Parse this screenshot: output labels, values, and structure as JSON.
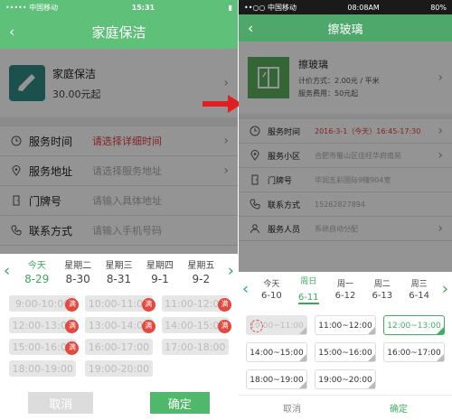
{
  "left": {
    "status": {
      "carrier": "••••• 中国移动",
      "time": "15:31",
      "battery": "▮"
    },
    "title": "家庭保洁",
    "service": {
      "name": "家庭保洁",
      "price": "30.00元起"
    },
    "rows": [
      {
        "label": "服务时间",
        "value": "请选择详细时间",
        "red": true,
        "icon": "clock-icon"
      },
      {
        "label": "服务地址",
        "value": "请选择服务地址",
        "red": false,
        "icon": "location-icon"
      },
      {
        "label": "门牌号",
        "value": "请输入具体地址",
        "red": false,
        "icon": "door-icon"
      },
      {
        "label": "联系方式",
        "value": "请输入手机号码",
        "red": false,
        "icon": "phone-icon"
      }
    ],
    "days": [
      {
        "name": "今天",
        "date": "8-29",
        "active": true
      },
      {
        "name": "星期二",
        "date": "8-30",
        "active": false
      },
      {
        "name": "星期三",
        "date": "8-31",
        "active": false
      },
      {
        "name": "星期四",
        "date": "9-1",
        "active": false
      },
      {
        "name": "星期五",
        "date": "9-2",
        "active": false
      }
    ],
    "slots": [
      {
        "label": "9:00-10:00",
        "state": "gray",
        "full": true
      },
      {
        "label": "10:00-11:00",
        "state": "gray",
        "full": true
      },
      {
        "label": "11:00-12:00",
        "state": "gray",
        "full": true
      },
      {
        "label": "12:00-13:00",
        "state": "gray",
        "full": true
      },
      {
        "label": "13:00-14:00",
        "state": "gray",
        "full": true
      },
      {
        "label": "14:00-15:00",
        "state": "gray",
        "full": true
      },
      {
        "label": "15:00-16:00",
        "state": "gray",
        "full": true
      },
      {
        "label": "16:00-17:00",
        "state": "gray",
        "full": false
      },
      {
        "label": "17:00-18:00",
        "state": "gray",
        "full": false
      },
      {
        "label": "18:00-19:00",
        "state": "gray",
        "full": false
      },
      {
        "label": "19:00-20:00",
        "state": "gray",
        "full": false
      }
    ],
    "full_label": "满",
    "cancel": "取消",
    "confirm": "确定"
  },
  "right": {
    "status": {
      "carrier": "••○○ 中国移动",
      "time": "08:08AM",
      "battery": "80%"
    },
    "title": "擦玻璃",
    "service": {
      "name": "擦玻璃",
      "line1": "计价方式：2.00元 / 平米",
      "line2": "服务费用：50元起"
    },
    "rows": [
      {
        "label": "服务时间",
        "value": "2016-3-1（今天）16:45-17:30",
        "red": true,
        "icon": "clock-icon"
      },
      {
        "label": "服务小区",
        "value": "合肥市蜀山区佳旺华府南苑",
        "red": false,
        "icon": "location-icon"
      },
      {
        "label": "门牌号",
        "value": "华润五彩国际9幢904室",
        "red": false,
        "icon": "door-icon"
      },
      {
        "label": "联系方式",
        "value": "15262827894",
        "red": false,
        "icon": "phone-icon"
      },
      {
        "label": "服务人员",
        "value": "系统自动分配",
        "red": false,
        "icon": "person-icon"
      }
    ],
    "days": [
      {
        "name": "今天",
        "date": "6-10",
        "active": false
      },
      {
        "name": "周日",
        "date": "6-11",
        "active": true
      },
      {
        "name": "周一",
        "date": "6-12",
        "active": false
      },
      {
        "name": "周二",
        "date": "6-13",
        "active": false
      },
      {
        "name": "周三",
        "date": "6-14",
        "active": false
      }
    ],
    "slots": [
      {
        "label": "10:00~11:00",
        "state": "gray",
        "full": false,
        "stamp": true
      },
      {
        "label": "11:00~12:00",
        "state": "normal",
        "full": false
      },
      {
        "label": "12:00~13:00",
        "state": "selected",
        "full": false
      },
      {
        "label": "14:00~15:00",
        "state": "normal",
        "full": false
      },
      {
        "label": "15:00~16:00",
        "state": "normal",
        "full": false
      },
      {
        "label": "16:00~17:00",
        "state": "normal",
        "full": false
      },
      {
        "label": "18:00~19:00",
        "state": "normal",
        "full": false
      },
      {
        "label": "19:00~20:00",
        "state": "normal",
        "full": false
      }
    ],
    "cancel": "取消",
    "confirm": "确定"
  },
  "colors": {
    "green": "#5fc07a",
    "accent": "#3fb062",
    "red": "#e13b3b"
  }
}
